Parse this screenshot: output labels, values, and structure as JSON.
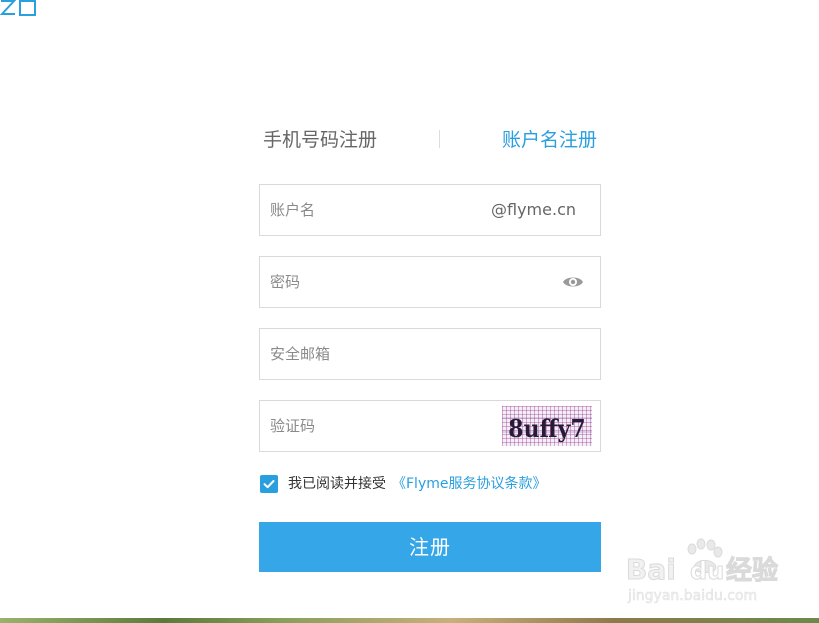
{
  "tabs": {
    "phone_register": "手机号码注册",
    "account_register": "账户名注册"
  },
  "fields": {
    "account": {
      "placeholder": "账户名",
      "suffix": "@flyme.cn"
    },
    "password": {
      "placeholder": "密码"
    },
    "email": {
      "placeholder": "安全邮箱"
    },
    "captcha": {
      "placeholder": "验证码",
      "image_text": "8uffy7"
    }
  },
  "agreement": {
    "checked": true,
    "text": "我已阅读并接受",
    "link": "《Flyme服务协议条款》"
  },
  "submit_label": "注册",
  "watermark": {
    "brand": "Bai",
    "brand2": "du",
    "label": "经验",
    "url": "jingyan.baidu.com"
  },
  "colors": {
    "accent": "#2a9fe0",
    "button": "#35a7e8"
  }
}
